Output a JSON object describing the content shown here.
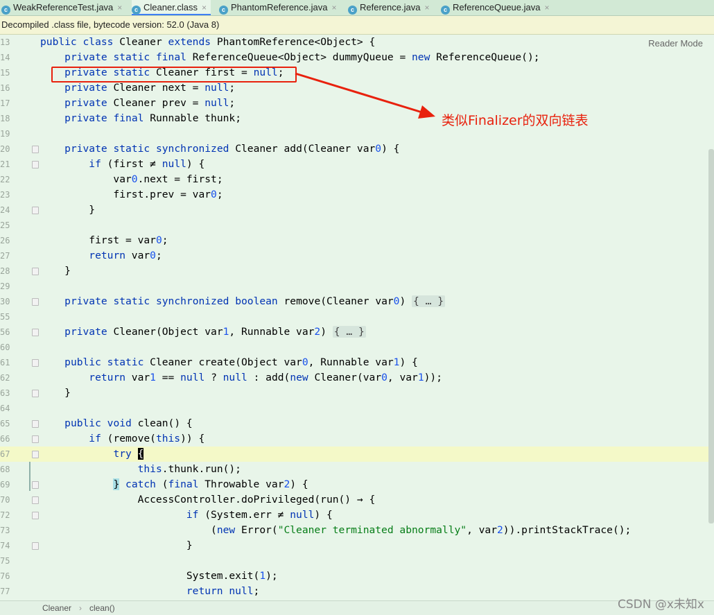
{
  "tabs": [
    {
      "label": "WeakReferenceTest.java",
      "icon": "class-icon",
      "active": false
    },
    {
      "label": "Cleaner.class",
      "icon": "class-icon",
      "active": true
    },
    {
      "label": "PhantomReference.java",
      "icon": "class-icon",
      "active": false
    },
    {
      "label": "Reference.java",
      "icon": "class-icon",
      "active": false
    },
    {
      "label": "ReferenceQueue.java",
      "icon": "class-icon",
      "active": false
    }
  ],
  "banner": {
    "text": "Decompiled .class file, bytecode version: 52.0 (Java 8)"
  },
  "reader_mode": "Reader Mode",
  "annotation": {
    "text": "类似Finalizer的双向链表",
    "color": "#e8210d"
  },
  "lines": [
    {
      "n": "13",
      "code": "public class Cleaner extends PhantomReference<Object> {"
    },
    {
      "n": "14",
      "code": "    private static final ReferenceQueue<Object> dummyQueue = new ReferenceQueue();"
    },
    {
      "n": "15",
      "code": "    private static Cleaner first = null;"
    },
    {
      "n": "16",
      "code": "    private Cleaner next = null;"
    },
    {
      "n": "17",
      "code": "    private Cleaner prev = null;"
    },
    {
      "n": "18",
      "code": "    private final Runnable thunk;"
    },
    {
      "n": "19",
      "code": ""
    },
    {
      "n": "20",
      "code": "    private static synchronized Cleaner add(Cleaner var0) {"
    },
    {
      "n": "21",
      "code": "        if (first ≠ null) {"
    },
    {
      "n": "22",
      "code": "            var0.next = first;"
    },
    {
      "n": "23",
      "code": "            first.prev = var0;"
    },
    {
      "n": "24",
      "code": "        }"
    },
    {
      "n": "25",
      "code": ""
    },
    {
      "n": "26",
      "code": "        first = var0;"
    },
    {
      "n": "27",
      "code": "        return var0;"
    },
    {
      "n": "28",
      "code": "    }"
    },
    {
      "n": "29",
      "code": ""
    },
    {
      "n": "30",
      "code": "    private static synchronized boolean remove(Cleaner var0) {...}"
    },
    {
      "n": "55",
      "code": ""
    },
    {
      "n": "56",
      "code": "    private Cleaner(Object var1, Runnable var2) {...}"
    },
    {
      "n": "60",
      "code": ""
    },
    {
      "n": "61",
      "code": "    public static Cleaner create(Object var0, Runnable var1) {"
    },
    {
      "n": "62",
      "code": "        return var1 == null ? null : add(new Cleaner(var0, var1));"
    },
    {
      "n": "63",
      "code": "    }"
    },
    {
      "n": "64",
      "code": ""
    },
    {
      "n": "65",
      "code": "    public void clean() {"
    },
    {
      "n": "66",
      "code": "        if (remove(this)) {"
    },
    {
      "n": "67",
      "code": "            try {"
    },
    {
      "n": "68",
      "code": "                this.thunk.run();"
    },
    {
      "n": "69",
      "code": "            } catch (final Throwable var2) {"
    },
    {
      "n": "70",
      "code": "                AccessController.doPrivileged(run() → {"
    },
    {
      "n": "72",
      "code": "                        if (System.err ≠ null) {"
    },
    {
      "n": "73",
      "code": "                            (new Error(\"Cleaner terminated abnormally\", var2)).printStackTrace();"
    },
    {
      "n": "74",
      "code": "                        }"
    },
    {
      "n": "75",
      "code": ""
    },
    {
      "n": "76",
      "code": "                        System.exit(1);"
    },
    {
      "n": "77",
      "code": "                        return null;"
    }
  ],
  "breadcrumb": [
    "Cleaner",
    "clean()"
  ],
  "breadcrumb_sep": "›",
  "watermark": "CSDN @x未知x"
}
